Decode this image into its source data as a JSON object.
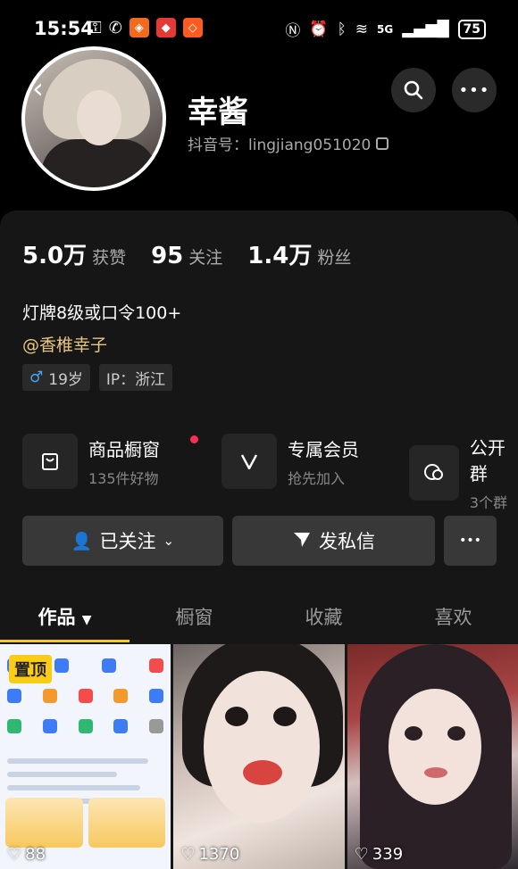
{
  "status_bar": {
    "time": "15:54",
    "battery": "75",
    "network": "5G"
  },
  "profile": {
    "nickname": "幸酱",
    "douyin_id": "抖音号：lingjiang051020",
    "stats": [
      {
        "num": "5.0万",
        "label": "获赞"
      },
      {
        "num": "95",
        "label": "关注"
      },
      {
        "num": "1.4万",
        "label": "粉丝"
      }
    ],
    "bio": "灯牌8级或口令100+",
    "mention": "@香椎幸子",
    "tags": {
      "gender_age": "19岁",
      "ip": "IP：浙江"
    }
  },
  "features": [
    {
      "title": "商品橱窗",
      "sub": "135件好物"
    },
    {
      "title": "专属会员",
      "sub": "抢先加入"
    },
    {
      "title": "公开群",
      "sub": "3个群"
    }
  ],
  "actions": {
    "follow": "已关注",
    "message": "发私信",
    "more": "•••"
  },
  "tabs": [
    "作品",
    "橱窗",
    "收藏",
    "喜欢"
  ],
  "videos": [
    {
      "pinned": "置顶",
      "likes": "88"
    },
    {
      "likes": "1370"
    },
    {
      "likes": "339"
    }
  ],
  "colors": {
    "accent": "#facc15",
    "mention": "#e8c680",
    "gender": "#4aa3f0",
    "red_dot": "#fe2c55"
  }
}
